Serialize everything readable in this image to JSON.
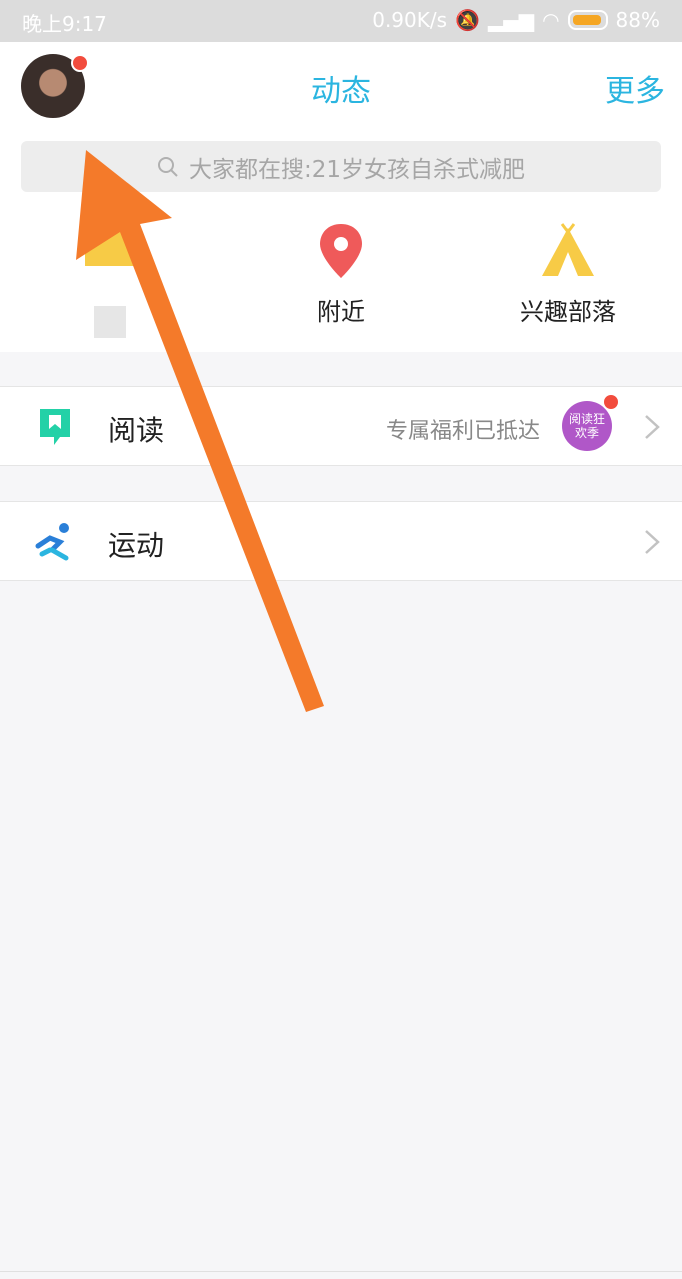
{
  "statusbar": {
    "time": "晚上9:17",
    "speed": "0.90K/s",
    "battery": "88%"
  },
  "header": {
    "title": "动态",
    "more": "更多",
    "search_placeholder": "大家都在搜:21岁女孩自杀式减肥"
  },
  "quick": [
    {
      "label": "",
      "icon": "house-icon"
    },
    {
      "label": "附近",
      "icon": "location-pin-icon"
    },
    {
      "label": "兴趣部落",
      "icon": "tent-icon"
    }
  ],
  "rows": [
    {
      "label": "阅读",
      "note": "专属福利已抵达",
      "badge": "阅读狂欢季",
      "icon": "bookmark-icon"
    },
    {
      "label": "运动",
      "note": "",
      "icon": "runner-icon"
    }
  ],
  "colors": {
    "accent": "#2bb5e0",
    "arrow": "#f47a2a",
    "notification": "#f24c3d",
    "pin": "#ef5a5a",
    "tent": "#f7cb46",
    "book": "#23d1a7"
  }
}
